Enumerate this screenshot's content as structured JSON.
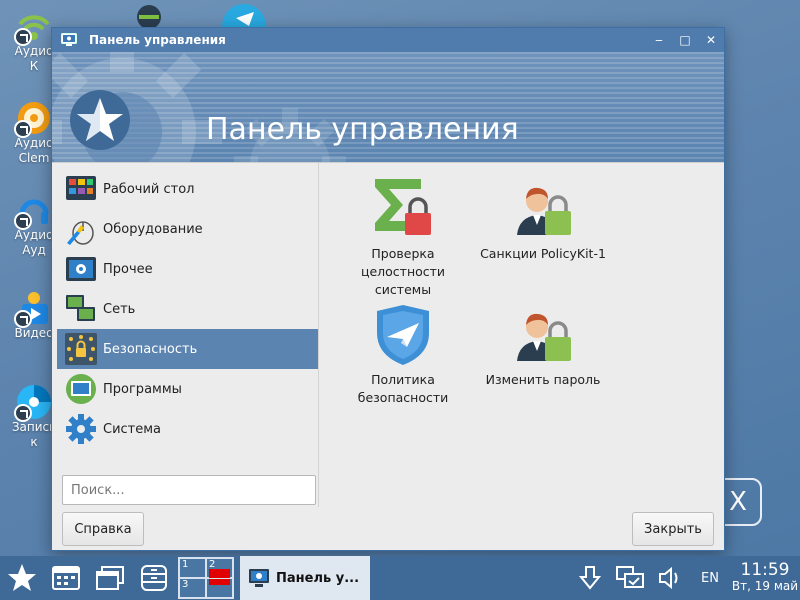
{
  "desktop": {
    "icons": [
      {
        "name": "audio-player-icon",
        "label": "Аудио\nК"
      },
      {
        "name": "clementine-icon",
        "label": "Аудио\nClem"
      },
      {
        "name": "audio-converter-icon",
        "label": "Аудио\nАуд"
      },
      {
        "name": "video-player-icon",
        "label": "Видео"
      },
      {
        "name": "disc-burner-icon",
        "label": "Запись\nк"
      }
    ]
  },
  "window": {
    "title": "Панель управления",
    "banner_title": "Панель управления",
    "sidebar": {
      "items": [
        {
          "label": "Рабочий стол",
          "icon": "desktop-icon"
        },
        {
          "label": "Оборудование",
          "icon": "hardware-icon"
        },
        {
          "label": "Прочее",
          "icon": "other-icon"
        },
        {
          "label": "Сеть",
          "icon": "network-icon"
        },
        {
          "label": "Безопасность",
          "icon": "security-icon",
          "active": true
        },
        {
          "label": "Программы",
          "icon": "programs-icon"
        },
        {
          "label": "Система",
          "icon": "system-icon"
        }
      ]
    },
    "search": {
      "placeholder": "Поиск...",
      "value": ""
    },
    "tiles": [
      {
        "label": "Проверка целостности системы",
        "icon": "sigma-lock-icon"
      },
      {
        "label": "Санкции PolicyKit-1",
        "icon": "user-lock-icon"
      },
      {
        "label": "Политика безопасности",
        "icon": "security-policy-icon"
      },
      {
        "label": "Изменить пароль",
        "icon": "user-lock-icon"
      }
    ],
    "help_button": "Справка",
    "close_button": "Закрыть"
  },
  "taskbar": {
    "workspaces": [
      "1",
      "2",
      "3",
      "4"
    ],
    "task_label": "Панель у...",
    "lang": "EN",
    "time": "11:59",
    "date": "Вт, 19 май"
  },
  "colors": {
    "accent": "#5c84b0",
    "titlebar": "#4f7cad",
    "taskbar": "#3f6a97"
  }
}
